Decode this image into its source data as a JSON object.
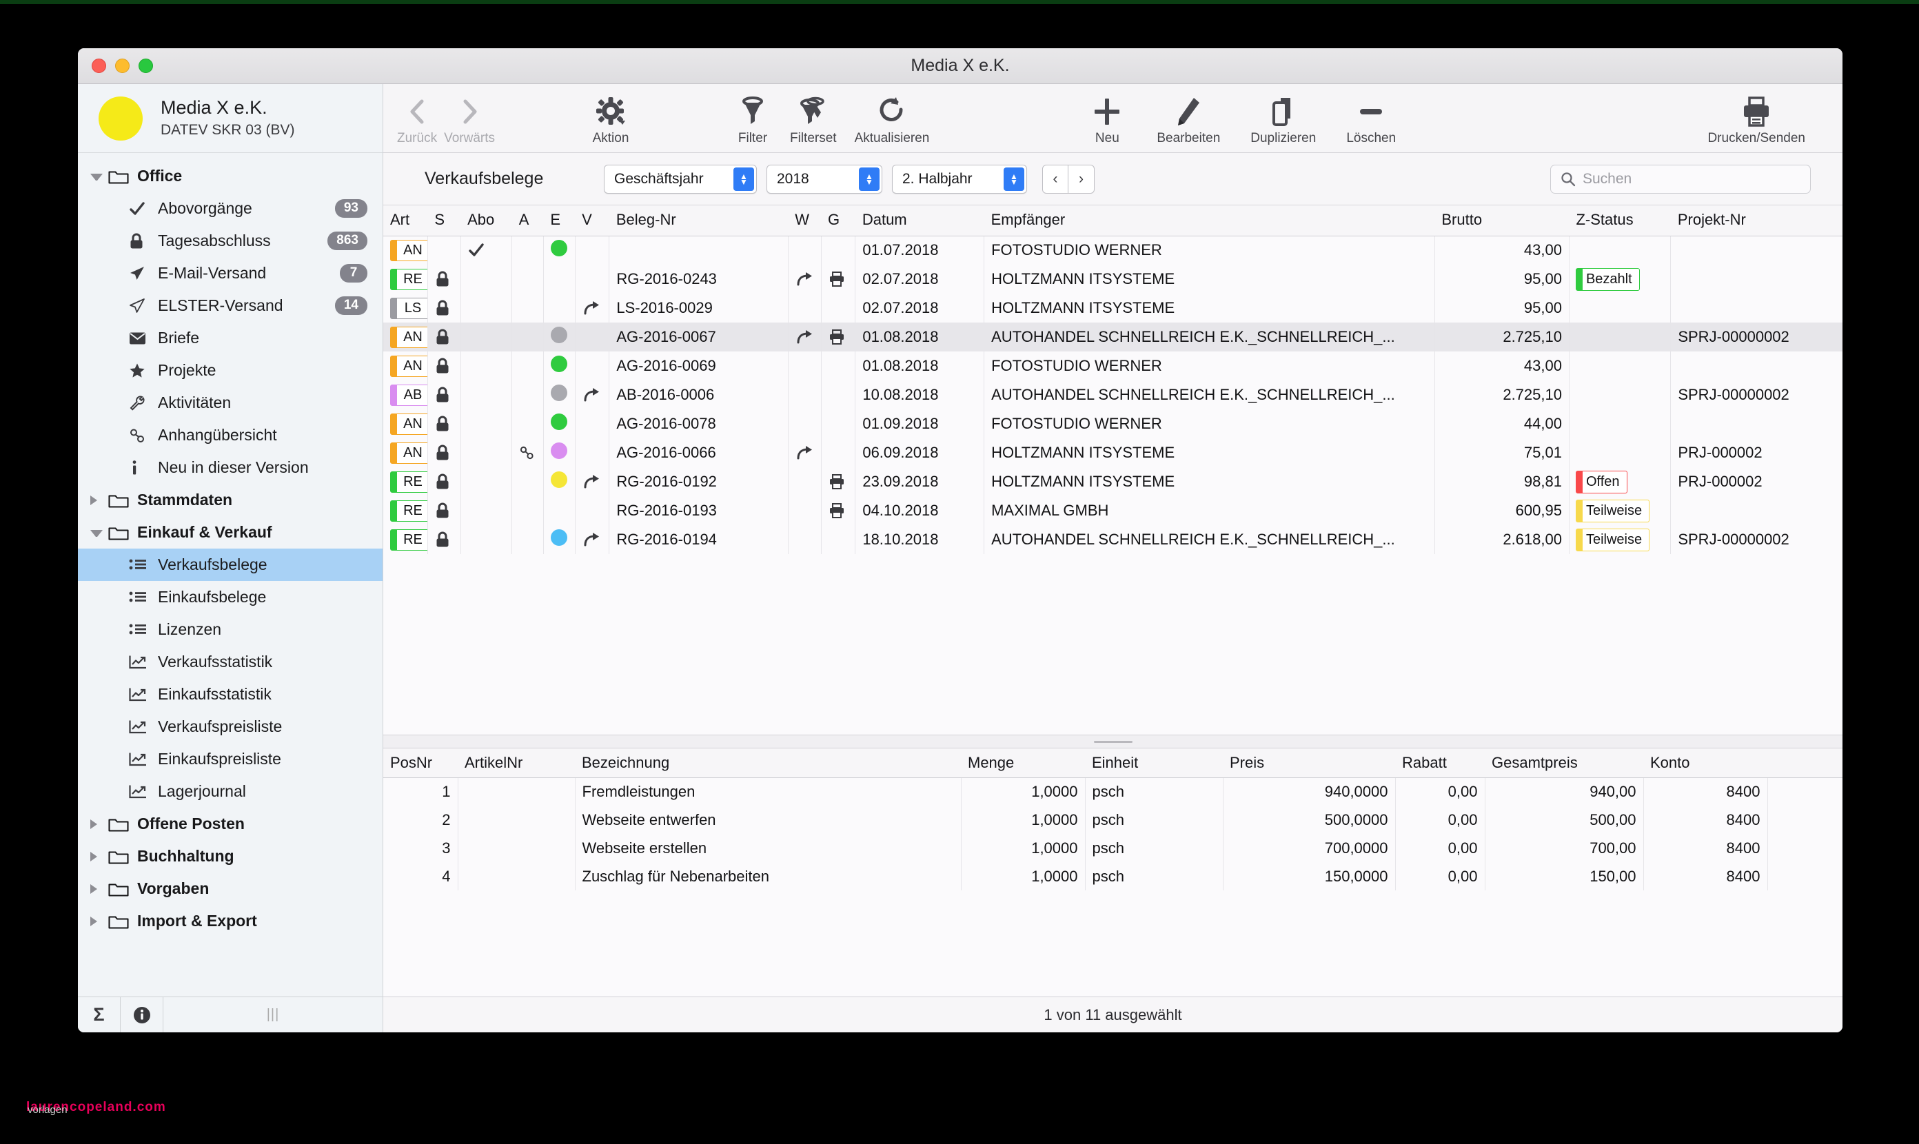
{
  "window": {
    "title": "Media X e.K."
  },
  "watermark": {
    "text": "laurencopeland.com",
    "sub": "vorlagen"
  },
  "sidebar": {
    "company": "Media X e.K.",
    "scheme": "DATEV SKR 03 (BV)",
    "groups": [
      {
        "label": "Office",
        "open": true,
        "icon": "folder-icon",
        "items": [
          {
            "label": "Abovorgänge",
            "icon": "check-icon",
            "badge": "93",
            "selected": false
          },
          {
            "label": "Tagesabschluss",
            "icon": "lock-icon",
            "badge": "863",
            "selected": false
          },
          {
            "label": "E-Mail-Versand",
            "icon": "send-icon",
            "badge": "7",
            "selected": false
          },
          {
            "label": "ELSTER-Versand",
            "icon": "send-outline-icon",
            "badge": "14",
            "selected": false
          },
          {
            "label": "Briefe",
            "icon": "envelope-icon",
            "badge": "",
            "selected": false
          },
          {
            "label": "Projekte",
            "icon": "star-icon",
            "badge": "",
            "selected": false
          },
          {
            "label": "Aktivitäten",
            "icon": "wrench-icon",
            "badge": "",
            "selected": false
          },
          {
            "label": "Anhangübersicht",
            "icon": "link-icon",
            "badge": "",
            "selected": false
          },
          {
            "label": "Neu in dieser Version",
            "icon": "info-icon",
            "badge": "",
            "selected": false
          }
        ]
      },
      {
        "label": "Stammdaten",
        "open": false,
        "icon": "folder-icon",
        "items": []
      },
      {
        "label": "Einkauf & Verkauf",
        "open": true,
        "icon": "folder-icon",
        "items": [
          {
            "label": "Verkaufsbelege",
            "icon": "list-icon",
            "badge": "",
            "selected": true
          },
          {
            "label": "Einkaufsbelege",
            "icon": "list-icon",
            "badge": "",
            "selected": false
          },
          {
            "label": "Lizenzen",
            "icon": "list-icon",
            "badge": "",
            "selected": false
          },
          {
            "label": "Verkaufsstatistik",
            "icon": "chart-icon",
            "badge": "",
            "selected": false
          },
          {
            "label": "Einkaufsstatistik",
            "icon": "chart-icon",
            "badge": "",
            "selected": false
          },
          {
            "label": "Verkaufspreisliste",
            "icon": "chart-icon",
            "badge": "",
            "selected": false
          },
          {
            "label": "Einkaufspreisliste",
            "icon": "chart-icon",
            "badge": "",
            "selected": false
          },
          {
            "label": "Lagerjournal",
            "icon": "chart-icon",
            "badge": "",
            "selected": false
          }
        ]
      },
      {
        "label": "Offene Posten",
        "open": false,
        "icon": "folder-icon",
        "items": []
      },
      {
        "label": "Buchhaltung",
        "open": false,
        "icon": "folder-icon",
        "items": []
      },
      {
        "label": "Vorgaben",
        "open": false,
        "icon": "folder-icon",
        "items": []
      },
      {
        "label": "Import & Export",
        "open": false,
        "icon": "folder-icon",
        "items": []
      }
    ],
    "footer": {
      "sum_icon": "sigma-icon",
      "info_icon": "info-circle-icon"
    }
  },
  "toolbar": {
    "back": "Zurück",
    "forward": "Vorwärts",
    "action": "Aktion",
    "filter": "Filter",
    "filterset": "Filterset",
    "refresh": "Aktualisieren",
    "new": "Neu",
    "edit": "Bearbeiten",
    "duplicate": "Duplizieren",
    "delete": "Löschen",
    "print": "Drucken/Senden"
  },
  "filterbar": {
    "title": "Verkaufsbelege",
    "period_type": "Geschäftsjahr",
    "year": "2018",
    "half": "2. Halbjahr",
    "prev": "‹",
    "next": "›",
    "search_placeholder": "Suchen"
  },
  "table": {
    "columns": [
      "Art",
      "S",
      "Abo",
      "A",
      "E",
      "V",
      "Beleg-Nr",
      "W",
      "G",
      "Datum",
      "Empfänger",
      "Brutto",
      "Z-Status",
      "Projekt-Nr"
    ],
    "rows": [
      {
        "art": "AN",
        "art_color": "#f5a623",
        "s": false,
        "abo": true,
        "a": "",
        "e": "#2fcb3f",
        "v": false,
        "beleg": "",
        "w": false,
        "g": false,
        "datum": "01.07.2018",
        "empf": "FOTOSTUDIO WERNER",
        "brutto": "43,00",
        "z": "",
        "z_color": "",
        "projekt": "",
        "selected": false
      },
      {
        "art": "RE",
        "art_color": "#2fcb3f",
        "s": true,
        "abo": false,
        "a": "",
        "e": "",
        "v": false,
        "beleg": "RG-2016-0243",
        "w": true,
        "g": true,
        "datum": "02.07.2018",
        "empf": "HOLTZMANN ITSYSTEME",
        "brutto": "95,00",
        "z": "Bezahlt",
        "z_color": "#2fcb3f",
        "projekt": "",
        "selected": false
      },
      {
        "art": "LS",
        "art_color": "#9b9ba1",
        "s": true,
        "abo": false,
        "a": "",
        "e": "",
        "v": true,
        "beleg": "LS-2016-0029",
        "w": false,
        "g": false,
        "datum": "02.07.2018",
        "empf": "HOLTZMANN ITSYSTEME",
        "brutto": "95,00",
        "z": "",
        "z_color": "",
        "projekt": "",
        "selected": false
      },
      {
        "art": "AN",
        "art_color": "#f5a623",
        "s": true,
        "abo": false,
        "a": "",
        "e": "#a9a9af",
        "v": false,
        "beleg": "AG-2016-0067",
        "w": true,
        "g": true,
        "datum": "01.08.2018",
        "empf": "AUTOHANDEL SCHNELLREICH E.K._SCHNELLREICH_...",
        "brutto": "2.725,10",
        "z": "",
        "z_color": "",
        "projekt": "SPRJ-00000002",
        "selected": true
      },
      {
        "art": "AN",
        "art_color": "#f5a623",
        "s": true,
        "abo": false,
        "a": "",
        "e": "#2fcb3f",
        "v": false,
        "beleg": "AG-2016-0069",
        "w": false,
        "g": false,
        "datum": "01.08.2018",
        "empf": "FOTOSTUDIO WERNER",
        "brutto": "43,00",
        "z": "",
        "z_color": "",
        "projekt": "",
        "selected": false
      },
      {
        "art": "AB",
        "art_color": "#d98df0",
        "s": true,
        "abo": false,
        "a": "",
        "e": "#a9a9af",
        "v": true,
        "beleg": "AB-2016-0006",
        "w": false,
        "g": false,
        "datum": "10.08.2018",
        "empf": "AUTOHANDEL SCHNELLREICH E.K._SCHNELLREICH_...",
        "brutto": "2.725,10",
        "z": "",
        "z_color": "",
        "projekt": "SPRJ-00000002",
        "selected": false
      },
      {
        "art": "AN",
        "art_color": "#f5a623",
        "s": true,
        "abo": false,
        "a": "",
        "e": "#2fcb3f",
        "v": false,
        "beleg": "AG-2016-0078",
        "w": false,
        "g": false,
        "datum": "01.09.2018",
        "empf": "FOTOSTUDIO WERNER",
        "brutto": "44,00",
        "z": "",
        "z_color": "",
        "projekt": "",
        "selected": false
      },
      {
        "art": "AN",
        "art_color": "#f5a623",
        "s": true,
        "abo": false,
        "a": "link",
        "e": "#d98df0",
        "v": false,
        "beleg": "AG-2016-0066",
        "w": true,
        "g": false,
        "datum": "06.09.2018",
        "empf": "HOLTZMANN ITSYSTEME",
        "brutto": "75,01",
        "z": "",
        "z_color": "",
        "projekt": "PRJ-000002",
        "selected": false
      },
      {
        "art": "RE",
        "art_color": "#2fcb3f",
        "s": true,
        "abo": false,
        "a": "",
        "e": "#f5e637",
        "v": true,
        "beleg": "RG-2016-0192",
        "w": false,
        "g": true,
        "datum": "23.09.2018",
        "empf": "HOLTZMANN ITSYSTEME",
        "brutto": "98,81",
        "z": "Offen",
        "z_color": "#f9484a",
        "projekt": "PRJ-000002",
        "selected": false
      },
      {
        "art": "RE",
        "art_color": "#2fcb3f",
        "s": true,
        "abo": false,
        "a": "",
        "e": "",
        "v": false,
        "beleg": "RG-2016-0193",
        "w": false,
        "g": true,
        "datum": "04.10.2018",
        "empf": "MAXIMAL GMBH",
        "brutto": "600,95",
        "z": "Teilweise",
        "z_color": "#f7d94c",
        "projekt": "",
        "selected": false
      },
      {
        "art": "RE",
        "art_color": "#2fcb3f",
        "s": true,
        "abo": false,
        "a": "",
        "e": "#4cbdf5",
        "v": true,
        "beleg": "RG-2016-0194",
        "w": false,
        "g": false,
        "datum": "18.10.2018",
        "empf": "AUTOHANDEL SCHNELLREICH E.K._SCHNELLREICH_...",
        "brutto": "2.618,00",
        "z": "Teilweise",
        "z_color": "#f7d94c",
        "projekt": "SPRJ-00000002",
        "selected": false
      }
    ]
  },
  "detail": {
    "columns": [
      "PosNr",
      "ArtikelNr",
      "Bezeichnung",
      "Menge",
      "Einheit",
      "Preis",
      "Rabatt",
      "Gesamtpreis",
      "Konto"
    ],
    "rows": [
      {
        "pos": "1",
        "artikel": "",
        "bez": "Fremdleistungen",
        "menge": "1,0000",
        "einheit": "psch",
        "preis": "940,0000",
        "rabatt": "0,00",
        "gesamt": "940,00",
        "konto": "8400"
      },
      {
        "pos": "2",
        "artikel": "",
        "bez": "Webseite entwerfen",
        "menge": "1,0000",
        "einheit": "psch",
        "preis": "500,0000",
        "rabatt": "0,00",
        "gesamt": "500,00",
        "konto": "8400"
      },
      {
        "pos": "3",
        "artikel": "",
        "bez": "Webseite erstellen",
        "menge": "1,0000",
        "einheit": "psch",
        "preis": "700,0000",
        "rabatt": "0,00",
        "gesamt": "700,00",
        "konto": "8400"
      },
      {
        "pos": "4",
        "artikel": "",
        "bez": "Zuschlag für Nebenarbeiten",
        "menge": "1,0000",
        "einheit": "psch",
        "preis": "150,0000",
        "rabatt": "0,00",
        "gesamt": "150,00",
        "konto": "8400"
      }
    ]
  },
  "statusbar": {
    "text": "1 von 11 ausgewählt"
  }
}
